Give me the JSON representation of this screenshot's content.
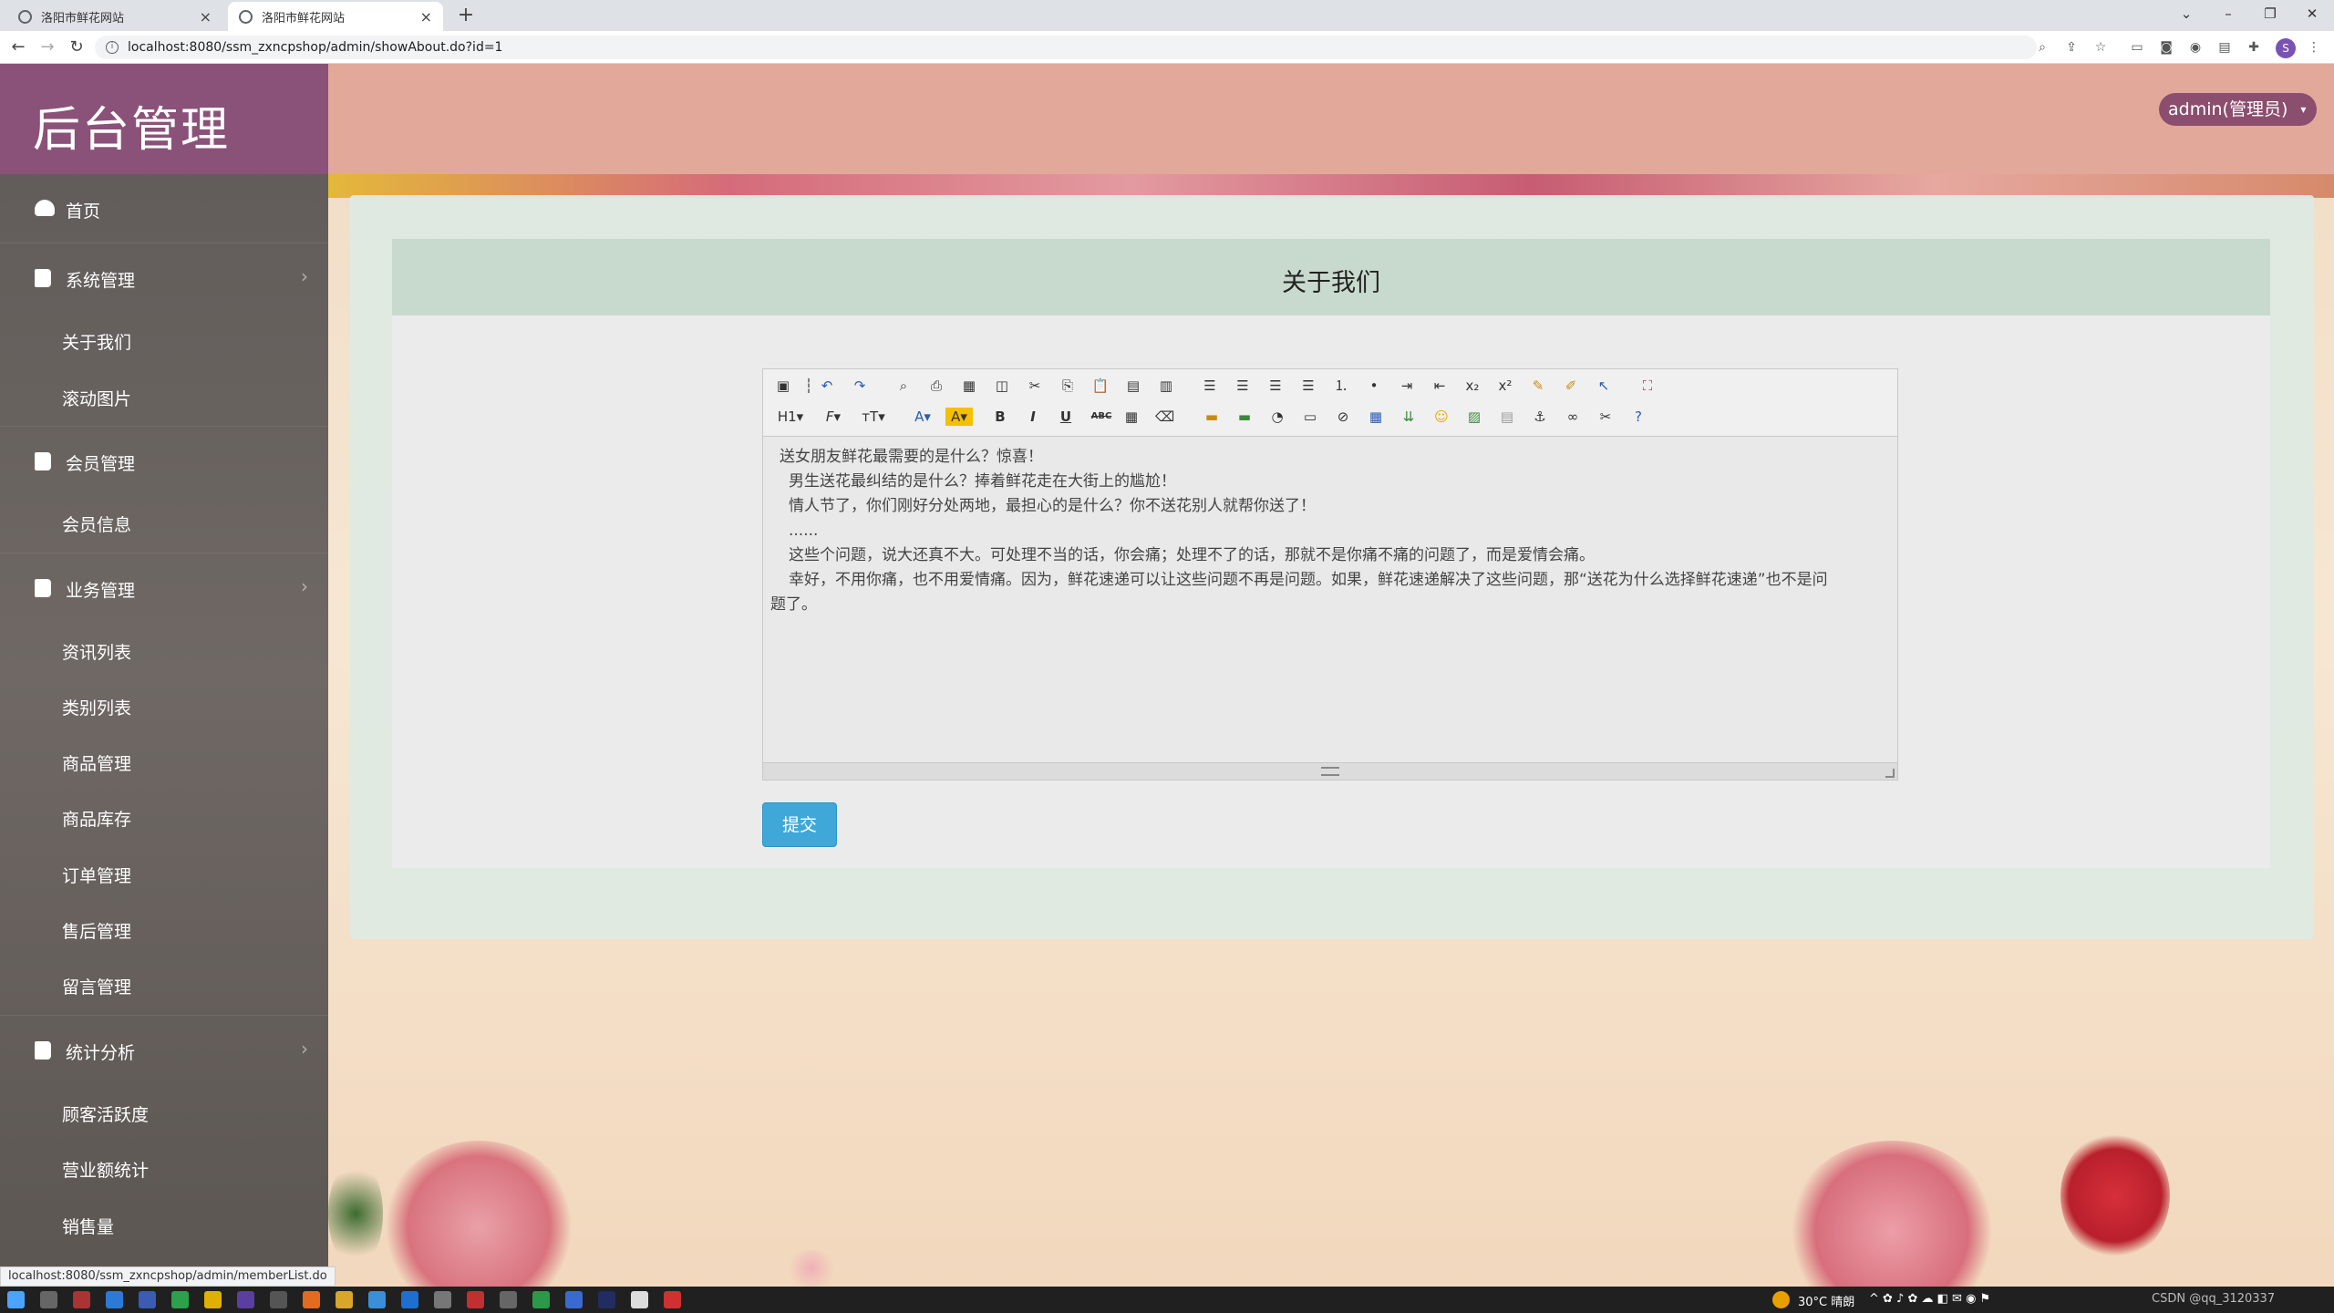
{
  "browser": {
    "tabs": [
      {
        "title": "洛阳市鲜花网站",
        "close": "×"
      },
      {
        "title": "洛阳市鲜花网站",
        "close": "×"
      }
    ],
    "new_tab": "+",
    "url": "localhost:8080/ssm_zxncpshop/admin/showAbout.do?id=1",
    "profile_initial": "S",
    "window_controls": [
      "⌄",
      "–",
      "❐",
      "✕"
    ]
  },
  "app": {
    "logo": "后台管理",
    "user_menu": "admin(管理员)",
    "sidebar": {
      "groups": [
        {
          "label": "首页",
          "icon": "dashboard-icon"
        },
        {
          "label": "系统管理",
          "icon": "book-icon",
          "items": [
            "关于我们",
            "滚动图片"
          ]
        },
        {
          "label": "会员管理",
          "icon": "book-icon",
          "items": [
            "会员信息"
          ]
        },
        {
          "label": "业务管理",
          "icon": "book-icon",
          "items": [
            "资讯列表",
            "类别列表",
            "商品管理",
            "商品库存",
            "订单管理",
            "售后管理",
            "留言管理"
          ]
        },
        {
          "label": "统计分析",
          "icon": "book-icon",
          "items": [
            "顾客活跃度",
            "营业额统计",
            "销售量"
          ]
        }
      ]
    },
    "panel": {
      "title": "关于我们",
      "editor": {
        "content_lines": [
          "送女朋友鲜花最需要的是什么？惊喜！",
          "男生送花最纠结的是什么？捧着鲜花走在大街上的尴尬！",
          "情人节了，你们刚好分处两地，最担心的是什么？你不送花别人就帮你送了！",
          "......",
          "这些个问题，说大还真不大。可处理不当的话，你会痛；处理不了的话，那就不是你痛不痛的问题了，而是爱情会痛。",
          "幸好，不用你痛，也不用爱情痛。因为，鲜花速递可以让这些问题不再是问题。如果，鲜花速递解决了这些问题，那“送花为什么选择鲜花速递”也不是问",
          "题了。"
        ],
        "toolbar_row2_labels": [
          "H1",
          "F",
          "T",
          "A",
          "A",
          "B",
          "I",
          "U",
          "ABC"
        ]
      },
      "submit_label": "提交"
    }
  },
  "status_url": "localhost:8080/ssm_zxncpshop/admin/memberList.do",
  "taskbar": {
    "weather": "30°C 晴朗",
    "watermark": "CSDN @qq_3120337"
  },
  "colors": {
    "logo_bg": "#8a5278",
    "topbar_bg": "#e2a99a",
    "user_menu_bg": "#8c4e6e",
    "sidebar_bg": "#625c59",
    "panel_head_bg": "#c8dacd",
    "submit_bg": "#3fa8d9"
  }
}
